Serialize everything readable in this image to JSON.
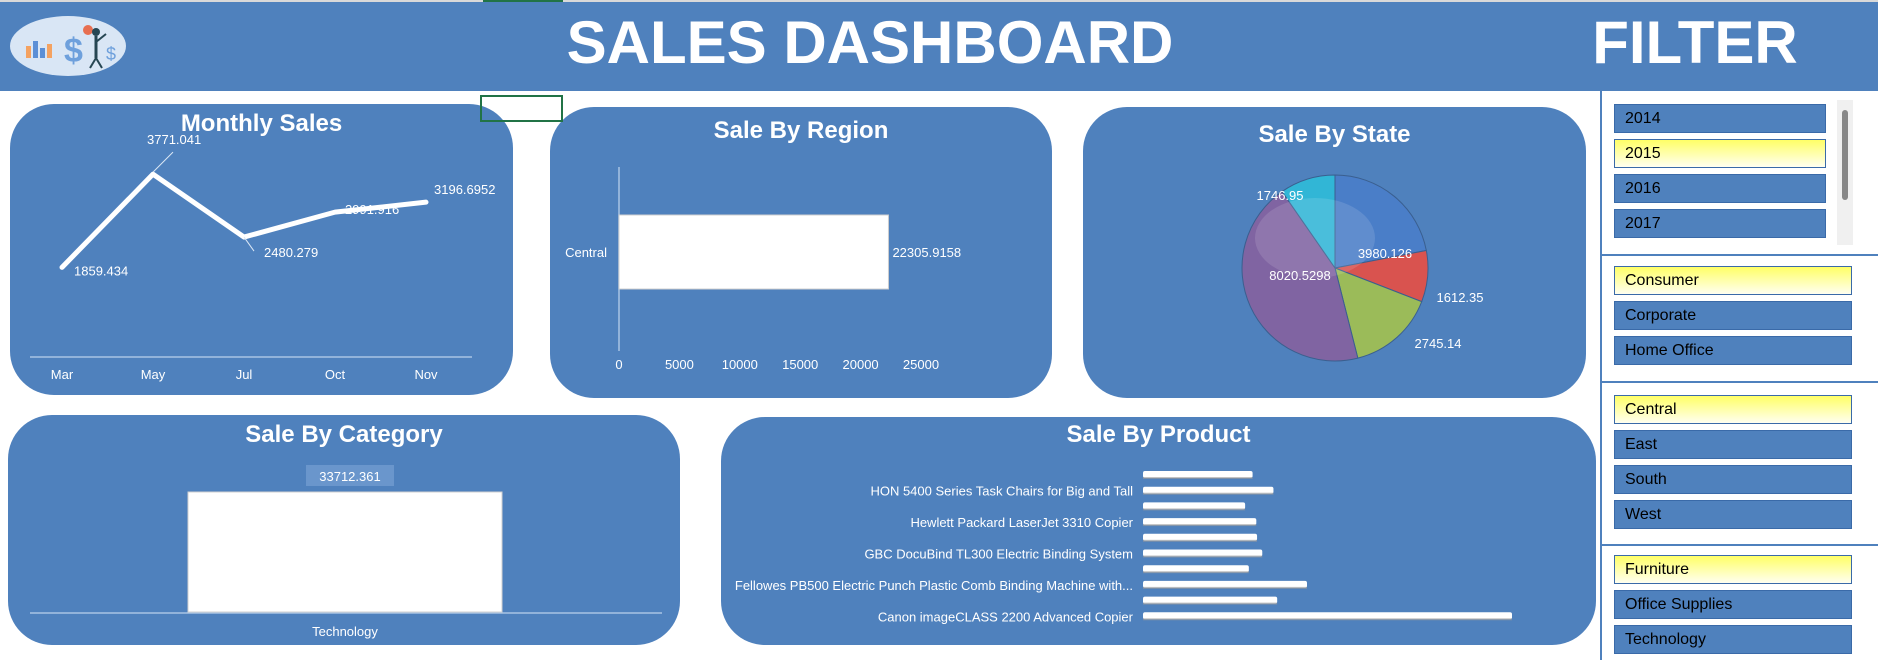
{
  "header": {
    "title": "SALES DASHBOARD",
    "filter_title": "FILTER"
  },
  "monthly_sales": {
    "title": "Monthly Sales",
    "chart_data": {
      "type": "line",
      "categories": [
        "Mar",
        "May",
        "Jul",
        "Oct",
        "Nov"
      ],
      "values": [
        1859.434,
        3771.041,
        2480.279,
        2991.916,
        3196.6952
      ],
      "labels": [
        "1859.434",
        "3771.041",
        "2480.279",
        "2991.916",
        "3196.6952"
      ]
    }
  },
  "sale_by_region": {
    "title": "Sale By Region",
    "chart_data": {
      "type": "bar",
      "orientation": "horizontal",
      "categories": [
        "Central"
      ],
      "values": [
        22305.9158
      ],
      "labels": [
        "22305.9158"
      ],
      "xlim": [
        0,
        25000
      ],
      "ticks": [
        "0",
        "5000",
        "10000",
        "15000",
        "20000",
        "25000"
      ]
    }
  },
  "sale_by_state": {
    "title": "Sale By State",
    "chart_data": {
      "type": "pie",
      "values": [
        3980.126,
        1612.35,
        2745.14,
        8020.5298,
        1746.95
      ],
      "labels": [
        "3980.126",
        "1612.35",
        "2745.14",
        "8020.5298",
        "1746.95"
      ],
      "colors": [
        "#4a7ec8",
        "#d9534f",
        "#9bbb59",
        "#8064a2",
        "#31b6d6"
      ]
    }
  },
  "sale_by_category": {
    "title": "Sale By Category",
    "chart_data": {
      "type": "bar",
      "categories": [
        "Technology"
      ],
      "values": [
        33712.361
      ],
      "labels": [
        "33712.361"
      ]
    }
  },
  "sale_by_product": {
    "title": "Sale By Product",
    "chart_data": {
      "type": "bar",
      "orientation": "horizontal",
      "categories": [
        "",
        "HON 5400 Series Task Chairs for Big and Tall",
        "",
        "Hewlett Packard LaserJet 3310 Copier",
        "",
        "GBC DocuBind TL300 Electric Binding System",
        "",
        "Fellowes PB500 Electric Punch Plastic Comb Binding Machine with...",
        "",
        "Canon imageCLASS 2200 Advanced Copier"
      ],
      "values": [
        1470,
        1750,
        1370,
        1520,
        1530,
        1600,
        1420,
        2200,
        1800,
        4950
      ]
    }
  },
  "filters": {
    "years": [
      {
        "label": "2014",
        "selected": false
      },
      {
        "label": "2015",
        "selected": true
      },
      {
        "label": "2016",
        "selected": false
      },
      {
        "label": "2017",
        "selected": false
      }
    ],
    "segments": [
      {
        "label": "Consumer",
        "selected": true
      },
      {
        "label": "Corporate",
        "selected": false
      },
      {
        "label": "Home Office",
        "selected": false
      }
    ],
    "regions": [
      {
        "label": "Central",
        "selected": true
      },
      {
        "label": "East",
        "selected": false
      },
      {
        "label": "South",
        "selected": false
      },
      {
        "label": "West",
        "selected": false
      }
    ],
    "categories": [
      {
        "label": "Furniture",
        "selected": true
      },
      {
        "label": "Office Supplies",
        "selected": false
      },
      {
        "label": "Technology",
        "selected": false
      }
    ]
  }
}
